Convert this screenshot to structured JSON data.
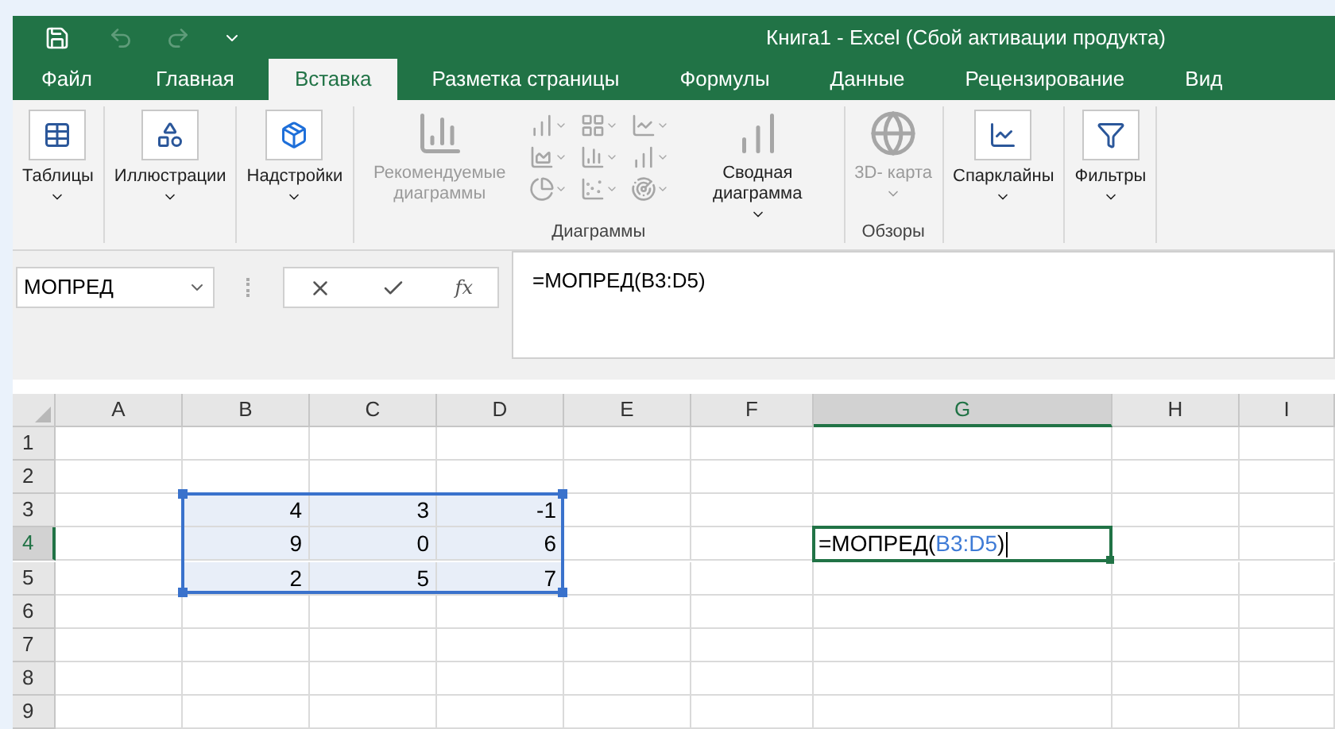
{
  "window": {
    "title": "Книга1 - Excel (Сбой активации продукта)"
  },
  "quick_access": [
    {
      "kind": "save",
      "disabled": false
    },
    {
      "kind": "undo",
      "disabled": true
    },
    {
      "kind": "redo",
      "disabled": true
    },
    {
      "kind": "customize",
      "disabled": false
    }
  ],
  "tabs": [
    {
      "label": "Файл",
      "selected": false
    },
    {
      "label": "Главная",
      "selected": false
    },
    {
      "label": "Вставка",
      "selected": true
    },
    {
      "label": "Разметка страницы",
      "selected": false
    },
    {
      "label": "Формулы",
      "selected": false
    },
    {
      "label": "Данные",
      "selected": false
    },
    {
      "label": "Рецензирование",
      "selected": false
    },
    {
      "label": "Вид",
      "selected": false
    }
  ],
  "ribbon": {
    "groups": [
      {
        "kind": "single",
        "buttons": [
          {
            "kind": "table",
            "label": "Таблицы",
            "dropdown": true,
            "disabled": false
          }
        ]
      },
      {
        "kind": "single",
        "buttons": [
          {
            "kind": "shapes",
            "label": "Иллюстрации",
            "dropdown": true,
            "disabled": false
          }
        ]
      },
      {
        "kind": "single",
        "buttons": [
          {
            "kind": "addin",
            "label": "Надстройки",
            "dropdown": true,
            "disabled": false
          }
        ]
      },
      {
        "kind": "charts",
        "title": "Диаграммы",
        "buttons": [
          {
            "kind": "recommended",
            "label": "Рекомендуемые диаграммы",
            "dropdown": false,
            "disabled": true
          },
          {
            "kind": "pivot",
            "label": "Сводная диаграмма",
            "dropdown": true,
            "disabled": false
          }
        ]
      },
      {
        "kind": "titled",
        "title": "Обзоры",
        "buttons": [
          {
            "kind": "globe",
            "label": "3D- карта",
            "dropdown": true,
            "disabled": true
          }
        ]
      },
      {
        "kind": "single",
        "buttons": [
          {
            "kind": "sparkline",
            "label": "Спарклайны",
            "dropdown": true,
            "disabled": false
          }
        ]
      },
      {
        "kind": "single",
        "buttons": [
          {
            "kind": "filter",
            "label": "Фильтры",
            "dropdown": true,
            "disabled": false
          }
        ]
      }
    ]
  },
  "name_box": {
    "value": "МОПРЕД"
  },
  "insert_function": {
    "label": "fx"
  },
  "formula_bar": {
    "value": "=МОПРЕД(B3:D5)"
  },
  "sheet": {
    "columns": [
      {
        "label": "A",
        "selected": false
      },
      {
        "label": "B",
        "selected": false
      },
      {
        "label": "C",
        "selected": false
      },
      {
        "label": "D",
        "selected": false
      },
      {
        "label": "E",
        "selected": false
      },
      {
        "label": "F",
        "selected": false
      },
      {
        "label": "G",
        "selected": true
      },
      {
        "label": "H",
        "selected": false
      },
      {
        "label": "I",
        "selected": false
      }
    ],
    "rows": [
      {
        "label": "1",
        "selected": false,
        "cells": []
      },
      {
        "label": "2",
        "selected": false,
        "cells": []
      },
      {
        "label": "3",
        "selected": false,
        "cells": [
          {
            "kind": "value",
            "in_range": false
          },
          {
            "kind": "value",
            "value": "4",
            "in_range": true
          },
          {
            "kind": "value",
            "value": "3",
            "in_range": true
          },
          {
            "kind": "value",
            "value": "-1",
            "in_range": true
          }
        ]
      },
      {
        "label": "4",
        "selected": true,
        "cells": [
          {
            "kind": "value",
            "in_range": false
          },
          {
            "kind": "value",
            "value": "9",
            "in_range": true
          },
          {
            "kind": "value",
            "value": "0",
            "in_range": true
          },
          {
            "kind": "value",
            "value": "6",
            "in_range": true
          },
          {
            "kind": "value",
            "in_range": false
          },
          {
            "kind": "value",
            "in_range": false
          },
          {
            "kind": "editing",
            "parts": [
              {
                "kind": "plain",
                "text": "=МОПРЕД("
              },
              {
                "kind": "ref",
                "text": "B3:D5"
              },
              {
                "kind": "plain",
                "text": ")"
              }
            ]
          }
        ]
      },
      {
        "label": "5",
        "selected": false,
        "cells": [
          {
            "kind": "value",
            "in_range": false
          },
          {
            "kind": "value",
            "value": "2",
            "in_range": true
          },
          {
            "kind": "value",
            "value": "5",
            "in_range": true
          },
          {
            "kind": "value",
            "value": "7",
            "in_range": true
          }
        ]
      },
      {
        "label": "6",
        "selected": false,
        "cells": []
      },
      {
        "label": "7",
        "selected": false,
        "cells": []
      },
      {
        "label": "8",
        "selected": false,
        "cells": []
      },
      {
        "label": "9",
        "selected": false,
        "cells": []
      }
    ]
  }
}
